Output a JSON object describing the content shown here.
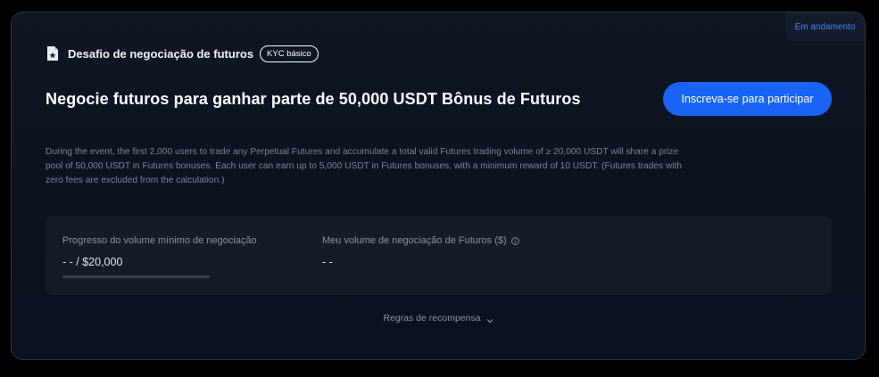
{
  "status": {
    "label": "Em andamento",
    "color": "#3f84ff"
  },
  "challenge": {
    "icon": "document-star-icon",
    "title": "Desafio de negociação de futuros",
    "badge": "KYC básico"
  },
  "headline": "Negocie futuros para ganhar parte de 50,000 USDT Bônus de Futuros",
  "join_button": {
    "label": "Inscreva-se para participar",
    "color": "#1a64f5"
  },
  "description": "During the event, the first 2,000 users to trade any Perpetual Futures and accumulate a total valid Futures trading volume of ≥ 20,000 USDT will share a prize pool of 50,000 USDT in Futures bonuses. Each user can earn up to 5,000 USDT in Futures bonuses, with a minimum reward of 10 USDT. (Futures trades with zero fees are excluded from the calculation.)",
  "progress": {
    "min_volume_label": "Progresso do volume mínimo de negociação",
    "min_volume_value": "- - / $20,000",
    "progress_fraction": 0,
    "my_volume_label": "Meu volume de negociação de Futuros ($)",
    "my_volume_value": "- -"
  },
  "rules_link": {
    "label": "Regras de recompensa",
    "icon": "chevron-down-icon"
  }
}
